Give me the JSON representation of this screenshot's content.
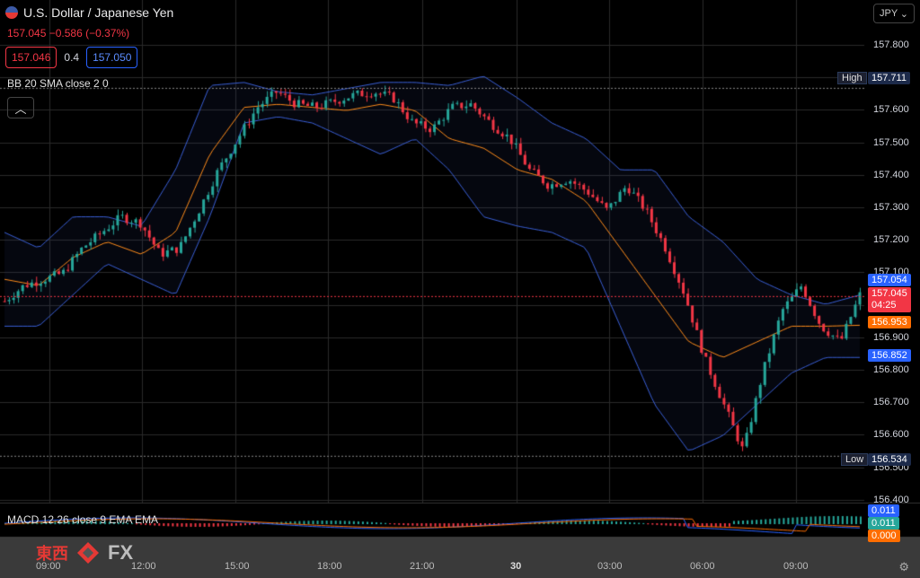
{
  "header": {
    "title": "U.S. Dollar / Japanese Yen",
    "price_line": "157.045  −0.586 (−0.37%)",
    "bid": "157.046",
    "spread": "0.4",
    "ask": "157.050"
  },
  "indicator_bb": "BB 20 SMA close 2 0",
  "indicator_macd": "MACD 12 26 close 9 EMA EMA",
  "currency_selector": "JPY",
  "y_axis": {
    "ticks": [
      "157.800",
      "157.700",
      "157.600",
      "157.500",
      "157.400",
      "157.300",
      "157.200",
      "157.100",
      "157.000",
      "156.900",
      "156.800",
      "156.700",
      "156.600",
      "156.500",
      "156.400"
    ]
  },
  "price_tags": {
    "high_label": "High",
    "high_value": "157.711",
    "low_label": "Low",
    "low_value": "156.534",
    "bb_upper": "157.054",
    "last": "157.045",
    "countdown": "04:25",
    "bb_mid": "156.953",
    "bb_lower": "156.852"
  },
  "macd_tags": {
    "v1": "0.011",
    "v2": "0.011",
    "v3": "0.000"
  },
  "x_axis": {
    "labels": [
      "09:00",
      "12:00",
      "15:00",
      "18:00",
      "21:00",
      "30",
      "03:00",
      "06:00",
      "09:00"
    ]
  },
  "logo": {
    "cn": "東西",
    "fx": "FX"
  },
  "colors": {
    "up": "#26a69a",
    "down": "#f23645",
    "bb_band": "#3a5fd6",
    "bb_mid": "#ff8c1a",
    "grid": "#2a2a2a"
  },
  "chart_data": {
    "type": "candlestick",
    "symbol": "USDJPY",
    "ylim": [
      156.4,
      157.85
    ],
    "close_path": [
      157.03,
      157.08,
      157.1,
      157.12,
      157.2,
      157.25,
      157.3,
      157.28,
      157.18,
      157.2,
      157.32,
      157.45,
      157.55,
      157.65,
      157.7,
      157.66,
      157.65,
      157.67,
      157.69,
      157.7,
      157.68,
      157.6,
      157.58,
      157.65,
      157.66,
      157.6,
      157.55,
      157.45,
      157.4,
      157.42,
      157.38,
      157.32,
      157.4,
      157.32,
      157.2,
      157.05,
      156.85,
      156.7,
      156.55,
      156.8,
      157.0,
      157.08,
      156.95,
      156.9,
      157.05
    ],
    "bb_upper_path": [
      157.25,
      157.2,
      157.3,
      157.3,
      157.27,
      157.45,
      157.72,
      157.73,
      157.7,
      157.69,
      157.71,
      157.73,
      157.73,
      157.72,
      157.75,
      157.68,
      157.6,
      157.55,
      157.45,
      157.45,
      157.3,
      157.22,
      157.1,
      157.05,
      157.02,
      157.05
    ],
    "bb_lower_path": [
      156.95,
      156.95,
      157.05,
      157.15,
      157.1,
      157.05,
      157.3,
      157.6,
      157.62,
      157.6,
      157.55,
      157.5,
      157.55,
      157.45,
      157.3,
      157.27,
      157.25,
      157.2,
      156.95,
      156.7,
      156.55,
      156.6,
      156.7,
      156.8,
      156.85,
      156.85
    ],
    "bb_mid_path": [
      157.1,
      157.08,
      157.17,
      157.22,
      157.18,
      157.25,
      157.5,
      157.65,
      157.66,
      157.65,
      157.64,
      157.66,
      157.64,
      157.55,
      157.52,
      157.45,
      157.42,
      157.35,
      157.2,
      157.05,
      156.9,
      156.85,
      156.9,
      156.95,
      156.95,
      156.953
    ]
  }
}
